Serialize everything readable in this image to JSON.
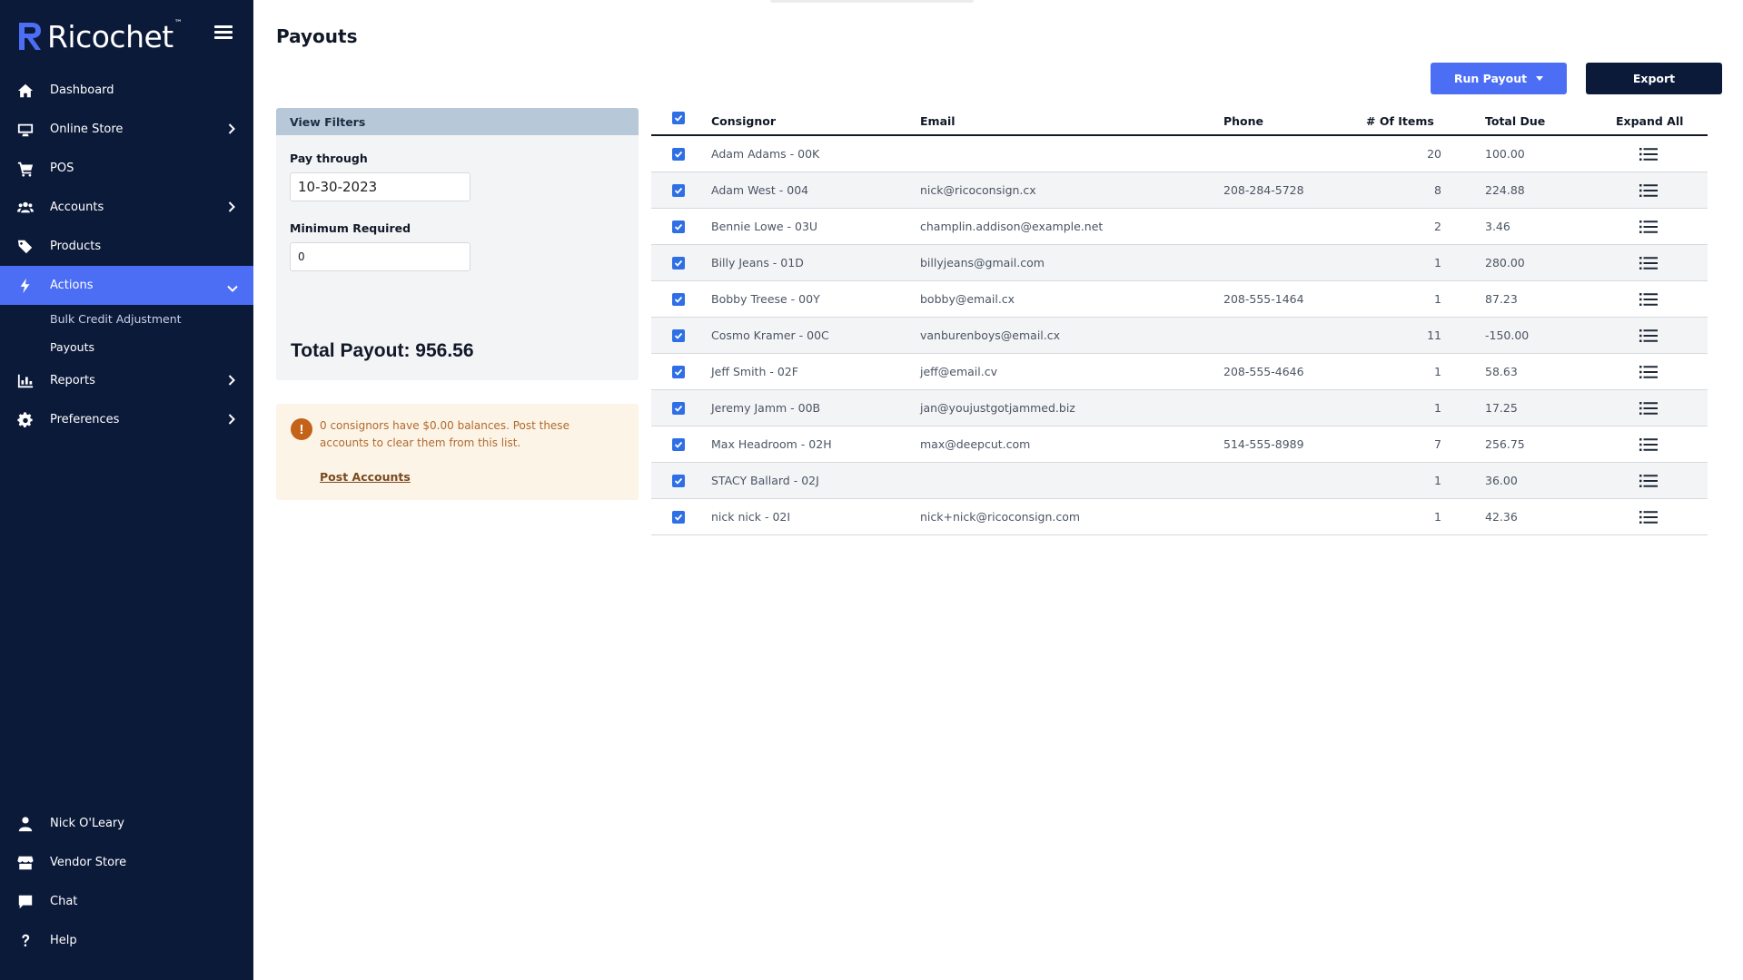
{
  "app": {
    "logo_text": "Ricochet",
    "logo_tm": "™"
  },
  "sidebar": {
    "items": [
      {
        "label": "Dashboard",
        "icon": "home-icon"
      },
      {
        "label": "Online Store",
        "icon": "monitor-icon"
      },
      {
        "label": "POS",
        "icon": "cart-icon"
      },
      {
        "label": "Accounts",
        "icon": "users-icon"
      },
      {
        "label": "Products",
        "icon": "tags-icon"
      },
      {
        "label": "Actions",
        "icon": "bolt-icon"
      },
      {
        "label": "Reports",
        "icon": "chart-icon"
      },
      {
        "label": "Preferences",
        "icon": "gear-icon"
      }
    ],
    "actions_sub": [
      "Bulk Credit Adjustment",
      "Payouts"
    ],
    "bottom": [
      {
        "label": "Nick O'Leary",
        "icon": "user-icon"
      },
      {
        "label": "Vendor Store",
        "icon": "store-icon"
      },
      {
        "label": "Chat",
        "icon": "chat-icon"
      },
      {
        "label": "Help",
        "icon": "question-icon"
      }
    ],
    "active_color": "#4c6ef5",
    "bg_color": "#0c1a3a"
  },
  "page": {
    "title": "Payouts",
    "run_payout_label": "Run Payout",
    "export_label": "Export"
  },
  "filters": {
    "header": "View Filters",
    "pay_through_label": "Pay through",
    "pay_through_value": "10-30-2023",
    "min_required_label": "Minimum Required",
    "min_required_value": "0",
    "total_payout": "Total Payout: 956.56"
  },
  "notice": {
    "text": "0 consignors have $0.00 balances. Post these accounts to clear them from this list.",
    "link": "Post Accounts"
  },
  "table": {
    "headers": {
      "consignor": "Consignor",
      "email": "Email",
      "phone": "Phone",
      "items": "# Of Items",
      "total": "Total Due",
      "expand": "Expand All"
    },
    "rows": [
      {
        "consignor": "Adam Adams - 00K",
        "email": "",
        "phone": "",
        "items": "20",
        "total": "100.00"
      },
      {
        "consignor": "Adam West - 004",
        "email": "nick@ricoconsign.cx",
        "phone": "208-284-5728",
        "items": "8",
        "total": "224.88"
      },
      {
        "consignor": "Bennie Lowe - 03U",
        "email": "champlin.addison@example.net",
        "phone": "",
        "items": "2",
        "total": "3.46"
      },
      {
        "consignor": "Billy Jeans - 01D",
        "email": "billyjeans@gmail.com",
        "phone": "",
        "items": "1",
        "total": "280.00"
      },
      {
        "consignor": "Bobby Treese - 00Y",
        "email": "bobby@email.cx",
        "phone": "208-555-1464",
        "items": "1",
        "total": "87.23"
      },
      {
        "consignor": "Cosmo Kramer - 00C",
        "email": "vanburenboys@email.cx",
        "phone": "",
        "items": "11",
        "total": "-150.00"
      },
      {
        "consignor": "Jeff Smith - 02F",
        "email": "jeff@email.cv",
        "phone": "208-555-4646",
        "items": "1",
        "total": "58.63"
      },
      {
        "consignor": "Jeremy Jamm - 00B",
        "email": "jan@youjustgotjammed.biz",
        "phone": "",
        "items": "1",
        "total": "17.25"
      },
      {
        "consignor": "Max Headroom - 02H",
        "email": "max@deepcut.com",
        "phone": "514-555-8989",
        "items": "7",
        "total": "256.75"
      },
      {
        "consignor": "STACY Ballard - 02J",
        "email": "",
        "phone": "",
        "items": "1",
        "total": "36.00"
      },
      {
        "consignor": "nick nick - 02I",
        "email": "nick+nick@ricoconsign.com",
        "phone": "",
        "items": "1",
        "total": "42.36"
      }
    ]
  }
}
